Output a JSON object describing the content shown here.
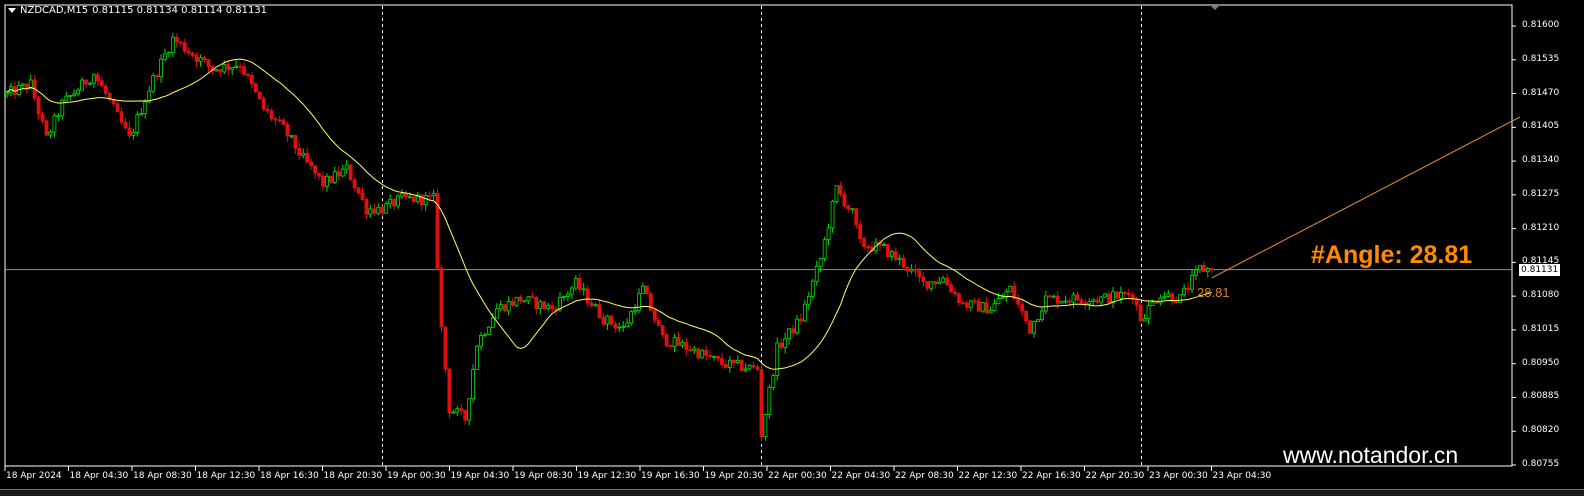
{
  "header": {
    "symbol": "NZDCAD,M15",
    "ohlc": "0.81115 0.81134 0.81114 0.81131"
  },
  "angle_label": "#Angle: 28.81",
  "angle_small": "28.81",
  "watermark": "www.notandor.cn",
  "colors": {
    "bull": "#00e000",
    "bear": "#e01010",
    "ma": "#ffff66",
    "trend": "#e8913a",
    "bid_line": "#909090",
    "angle": "#ff8c00"
  },
  "chart_data": {
    "type": "candlestick",
    "title": "NZDCAD,M15",
    "ylim": [
      0.80755,
      0.816
    ],
    "y_ticks": [
      "0.81600",
      "0.81535",
      "0.81470",
      "0.81405",
      "0.81340",
      "0.81275",
      "0.81210",
      "0.81145",
      "0.81080",
      "0.81015",
      "0.80950",
      "0.80885",
      "0.80820",
      "0.80755"
    ],
    "x_ticks": [
      "18 Apr 2024",
      "18 Apr 04:30",
      "18 Apr 08:30",
      "18 Apr 12:30",
      "18 Apr 16:30",
      "18 Apr 20:30",
      "19 Apr 00:30",
      "19 Apr 04:30",
      "19 Apr 08:30",
      "19 Apr 12:30",
      "19 Apr 16:30",
      "19 Apr 20:30",
      "22 Apr 00:30",
      "22 Apr 04:30",
      "22 Apr 08:30",
      "22 Apr 12:30",
      "22 Apr 16:30",
      "22 Apr 20:30",
      "23 Apr 00:30",
      "23 Apr 04:30"
    ],
    "bar_count": 306,
    "day_separators_bar": [
      95,
      191,
      287
    ],
    "bid_price": "0.81131",
    "ma_period": 21,
    "price_path": [
      [
        0,
        0.81469
      ],
      [
        6,
        0.81488
      ],
      [
        10,
        0.81383
      ],
      [
        14,
        0.8145
      ],
      [
        22,
        0.81508
      ],
      [
        25,
        0.81469
      ],
      [
        31,
        0.81383
      ],
      [
        37,
        0.81498
      ],
      [
        42,
        0.81575
      ],
      [
        47,
        0.81546
      ],
      [
        52,
        0.81517
      ],
      [
        59,
        0.81527
      ],
      [
        65,
        0.8144
      ],
      [
        70,
        0.81402
      ],
      [
        75,
        0.81344
      ],
      [
        80,
        0.81296
      ],
      [
        86,
        0.81325
      ],
      [
        91,
        0.81248
      ],
      [
        95,
        0.81248
      ],
      [
        100,
        0.81267
      ],
      [
        108,
        0.81267
      ],
      [
        110,
        0.81017
      ],
      [
        112,
        0.80864
      ],
      [
        116,
        0.80844
      ],
      [
        119,
        0.80989
      ],
      [
        124,
        0.81056
      ],
      [
        130,
        0.81075
      ],
      [
        138,
        0.81056
      ],
      [
        144,
        0.81104
      ],
      [
        151,
        0.81037
      ],
      [
        156,
        0.81017
      ],
      [
        161,
        0.81094
      ],
      [
        166,
        0.80998
      ],
      [
        173,
        0.80979
      ],
      [
        181,
        0.8095
      ],
      [
        190,
        0.8094
      ],
      [
        191,
        0.80815
      ],
      [
        195,
        0.80979
      ],
      [
        201,
        0.81037
      ],
      [
        206,
        0.81152
      ],
      [
        210,
        0.81287
      ],
      [
        214,
        0.81239
      ],
      [
        216,
        0.81181
      ],
      [
        222,
        0.81171
      ],
      [
        227,
        0.81142
      ],
      [
        232,
        0.81104
      ],
      [
        237,
        0.81114
      ],
      [
        242,
        0.81065
      ],
      [
        249,
        0.81056
      ],
      [
        254,
        0.81094
      ],
      [
        259,
        0.81017
      ],
      [
        263,
        0.81075
      ],
      [
        270,
        0.81075
      ],
      [
        277,
        0.81075
      ],
      [
        285,
        0.81085
      ],
      [
        287,
        0.81037
      ],
      [
        292,
        0.81085
      ],
      [
        297,
        0.81075
      ],
      [
        302,
        0.81133
      ],
      [
        305,
        0.81131
      ]
    ],
    "trendline": {
      "start_bar": 305,
      "start_price": 0.81115,
      "end_price_at_axis": 0.81425,
      "angle_deg": 28.81
    }
  }
}
